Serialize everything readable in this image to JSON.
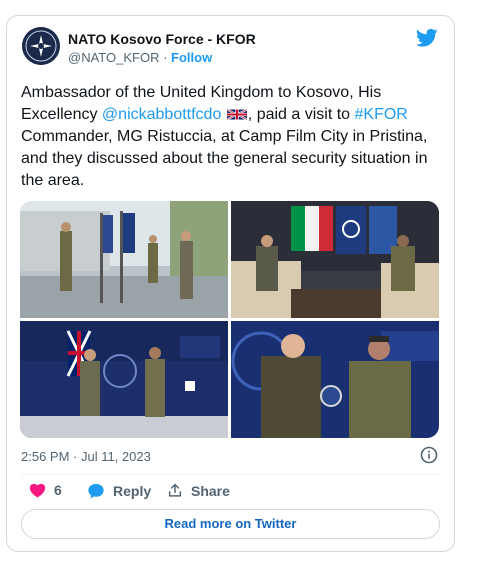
{
  "author": {
    "name": "NATO Kosovo Force - KFOR",
    "handle": "@NATO_KFOR",
    "separator": "·",
    "follow_label": "Follow"
  },
  "tweet": {
    "text_1": "Ambassador of the United Kingdom to Kosovo, His Excellency ",
    "mention": "@nickabbottfcdo",
    "text_2": ", paid a visit to ",
    "hashtag": "#KFOR",
    "text_3": " Commander, MG Ristuccia, at Camp Film City in Pristina, and they discussed about the general security situation in the area."
  },
  "timestamp": "2:56 PM · Jul 11, 2023",
  "actions": {
    "likes_count": "6",
    "reply_label": "Reply",
    "share_label": "Share"
  },
  "read_more_label": "Read more on Twitter",
  "colors": {
    "accent": "#1d9bf0",
    "like": "#f91880",
    "read_more": "#1467c2"
  },
  "icons": [
    "twitter-bird-icon",
    "uk-flag-icon",
    "info-icon",
    "heart-icon",
    "reply-bubble-icon",
    "share-icon"
  ]
}
